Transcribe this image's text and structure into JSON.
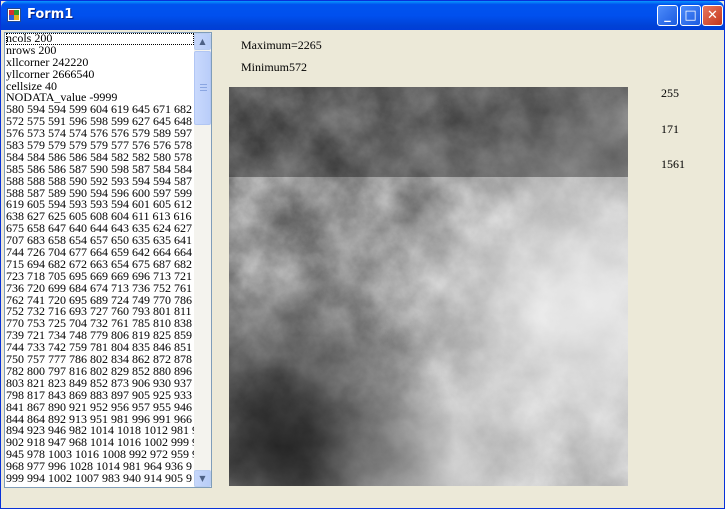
{
  "window": {
    "title": "Form1",
    "buttons": {
      "minimize": "_",
      "maximize": "□",
      "close": "✕"
    }
  },
  "header_lines": [
    "ncols 200",
    "nrows 200",
    "xllcorner 242220",
    "yllcorner 2666540",
    "cellsize 40",
    "NODATA_value -9999"
  ],
  "data_lines": [
    "580 594 594 599 604 619 645 671 682",
    "572 575 591 596 598 599 627 645 648",
    "576 573 574 574 576 576 579 589 597",
    "583 579 579 579 579 577 576 576 578",
    "584 584 586 586 584 582 582 580 578",
    "585 586 586 587 590 598 587 584 584",
    "588 588 588 590 592 593 594 594 587",
    "588 587 589 590 594 596 600 597 599",
    "619 605 594 593 593 594 601 605 612",
    "638 627 625 605 608 604 611 613 616",
    "675 658 647 640 644 643 635 624 627",
    "707 683 658 654 657 650 635 635 641",
    "744 726 704 677 664 659 642 664 664",
    "715 694 682 672 663 654 675 687 682",
    "723 718 705 695 669 669 696 713 721",
    "736 720 699 684 674 713 736 752 761",
    "762 741 720 695 689 724 749 770 786",
    "752 732 716 693 727 760 793 801 811",
    "770 753 725 704 732 761 785 810 838",
    "739 721 734 748 779 806 819 825 859",
    "744 733 742 759 781 804 835 846 851",
    "750 757 777 786 802 834 862 872 878",
    "782 800 797 816 802 829 852 880 896",
    "803 821 823 849 852 873 906 930 937",
    "798 817 843 869 883 897 905 925 933",
    "841 867 890 921 952 956 957 955 946",
    "844 864 892 913 951 981 996 991 966",
    "894 923 946 982 1014 1018 1012 981 9",
    "902 918 947 968 1014 1016 1002 999 9",
    "945 978 1003 1016 1008 992 972 959 9",
    "968 977 996 1028 1014 981 964 936 9",
    "999 994 1002 1007 983 940 914 905 9"
  ],
  "maximum_label": "Maximum=2265",
  "minimum_label": "Minimum572",
  "side_values": [
    "255",
    "171",
    "1561"
  ],
  "image_name": "dem-hillshade-image",
  "colors": {
    "titlebar": "#0050ee",
    "face": "#ece9d8",
    "list_border": "#7f9db9"
  }
}
